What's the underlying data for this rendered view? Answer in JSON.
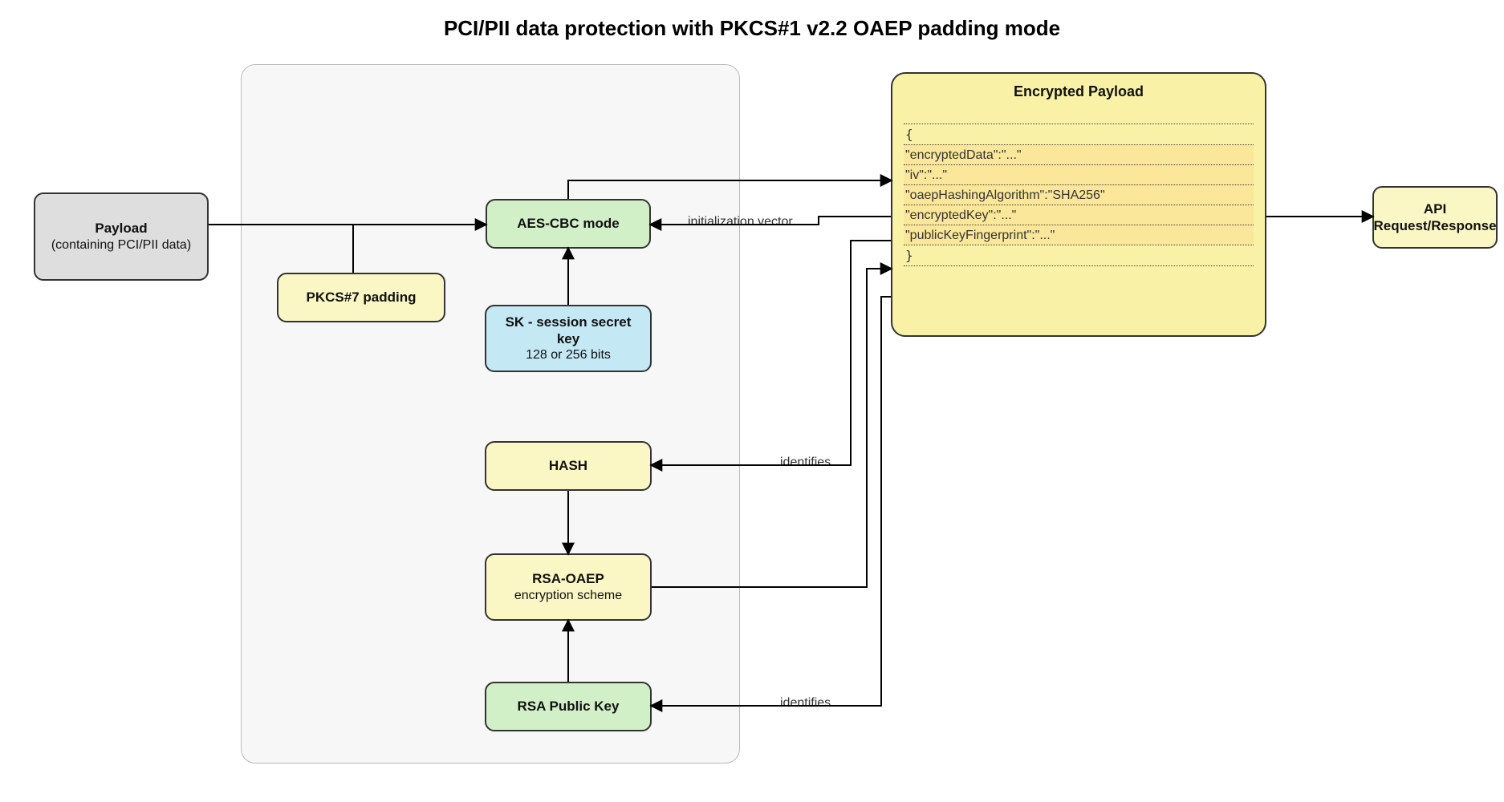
{
  "title": "PCI/PII data protection with PKCS#1 v2.2 OAEP padding mode",
  "nodes": {
    "payload": {
      "title": "Payload",
      "sub": "(containing PCI/PII data)"
    },
    "pkcs7": {
      "label": "PKCS#7 padding"
    },
    "aes": {
      "label": "AES-CBC mode"
    },
    "sk": {
      "title": "SK - session secret key",
      "sub": "128 or 256 bits"
    },
    "hash": {
      "label": "HASH"
    },
    "rsaoaep": {
      "title": "RSA-OAEP",
      "sub": "encryption scheme"
    },
    "rsapub": {
      "label": "RSA Public Key"
    },
    "api": {
      "title": "API",
      "sub": "Request/Response"
    }
  },
  "encryptedPayload": {
    "title": "Encrypted Payload",
    "open": "{",
    "rows": [
      "\"encryptedData\":\"...\"",
      "\"iv\":\"...\"",
      "\"oaepHashingAlgorithm\":\"SHA256\"",
      "\"encryptedKey\":\"...\"",
      "\"publicKeyFingerprint\":\"...\""
    ],
    "close": "}"
  },
  "edgeLabels": {
    "iv": "initialization vector",
    "identHash": "identifies",
    "identKey": "identifies"
  }
}
